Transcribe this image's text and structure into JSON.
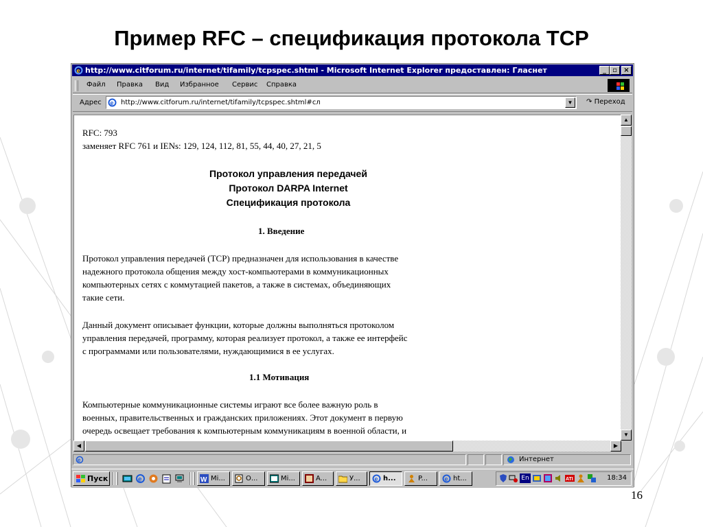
{
  "slide": {
    "title": "Пример RFC – спецификация протокола TCP",
    "page_number": "16"
  },
  "window": {
    "title": "http://www.citforum.ru/internet/tifamily/tcpspec.shtml - Microsoft Internet Explorer предоставлен: Гласнет",
    "buttons": {
      "minimize": "_",
      "maximize": "▫",
      "close": "×"
    }
  },
  "menu": [
    "Файл",
    "Правка",
    "Вид",
    "Избранное",
    "Сервис",
    "Справка"
  ],
  "address": {
    "label": "Адрес",
    "value": "http://www.citforum.ru/internet/tifamily/tcpspec.shtml#сл",
    "go_label": "Переход"
  },
  "document": {
    "rfc_line": "RFC: 793",
    "replaces_line": "заменяет RFC 761 и IENs: 129, 124, 112, 81, 55, 44, 40, 27, 21, 5",
    "heading": [
      "Протокол управления передачей",
      "Протокол DARPA Internet",
      "Спецификация протокола"
    ],
    "section1_title": "1. Введение",
    "para1": [
      "Протокол управления передачей (TCP) предназначен для использования в качестве",
      "надежного протокола общения между хост-компьютерами в коммуникационных",
      "компьютерных сетях с коммутацией пакетов, а также в системах, объединяющих",
      "такие сети."
    ],
    "para2": [
      "Данный документ описывает функции, которые должны выполняться протоколом",
      "управления передачей, программу, которая реализует протокол, а также ее интерфейс",
      "с программами или пользователями, нуждающимися в ее услугах."
    ],
    "section11_title": "1.1 Мотивация",
    "para3": [
      "Компьютерные коммуникационные системы играют все более важную роль в",
      "военных, правительственных и гражданских приложениях. Этот документ в первую",
      "очередь освещает требования к компьютерным коммуникациям в военной области, и"
    ]
  },
  "status": {
    "zone": "Интернет"
  },
  "taskbar": {
    "start_label": "Пуск",
    "tasks": [
      {
        "label": "Mi...",
        "icon": "word-icon",
        "active": false
      },
      {
        "label": "О...",
        "icon": "search-doc-icon",
        "active": false
      },
      {
        "label": "Mi...",
        "icon": "app-window-icon",
        "active": false
      },
      {
        "label": "A...",
        "icon": "image-app-icon",
        "active": false
      },
      {
        "label": "У...",
        "icon": "folder-icon",
        "active": false
      },
      {
        "label": "h...",
        "icon": "ie-icon",
        "active": true
      },
      {
        "label": "P...",
        "icon": "person-icon",
        "active": false
      },
      {
        "label": "ht...",
        "icon": "ie-icon",
        "active": false
      }
    ],
    "tray_lang": "En",
    "clock": "18:34"
  },
  "colors": {
    "titlebar": "#000080",
    "chrome": "#c0c0c0"
  }
}
